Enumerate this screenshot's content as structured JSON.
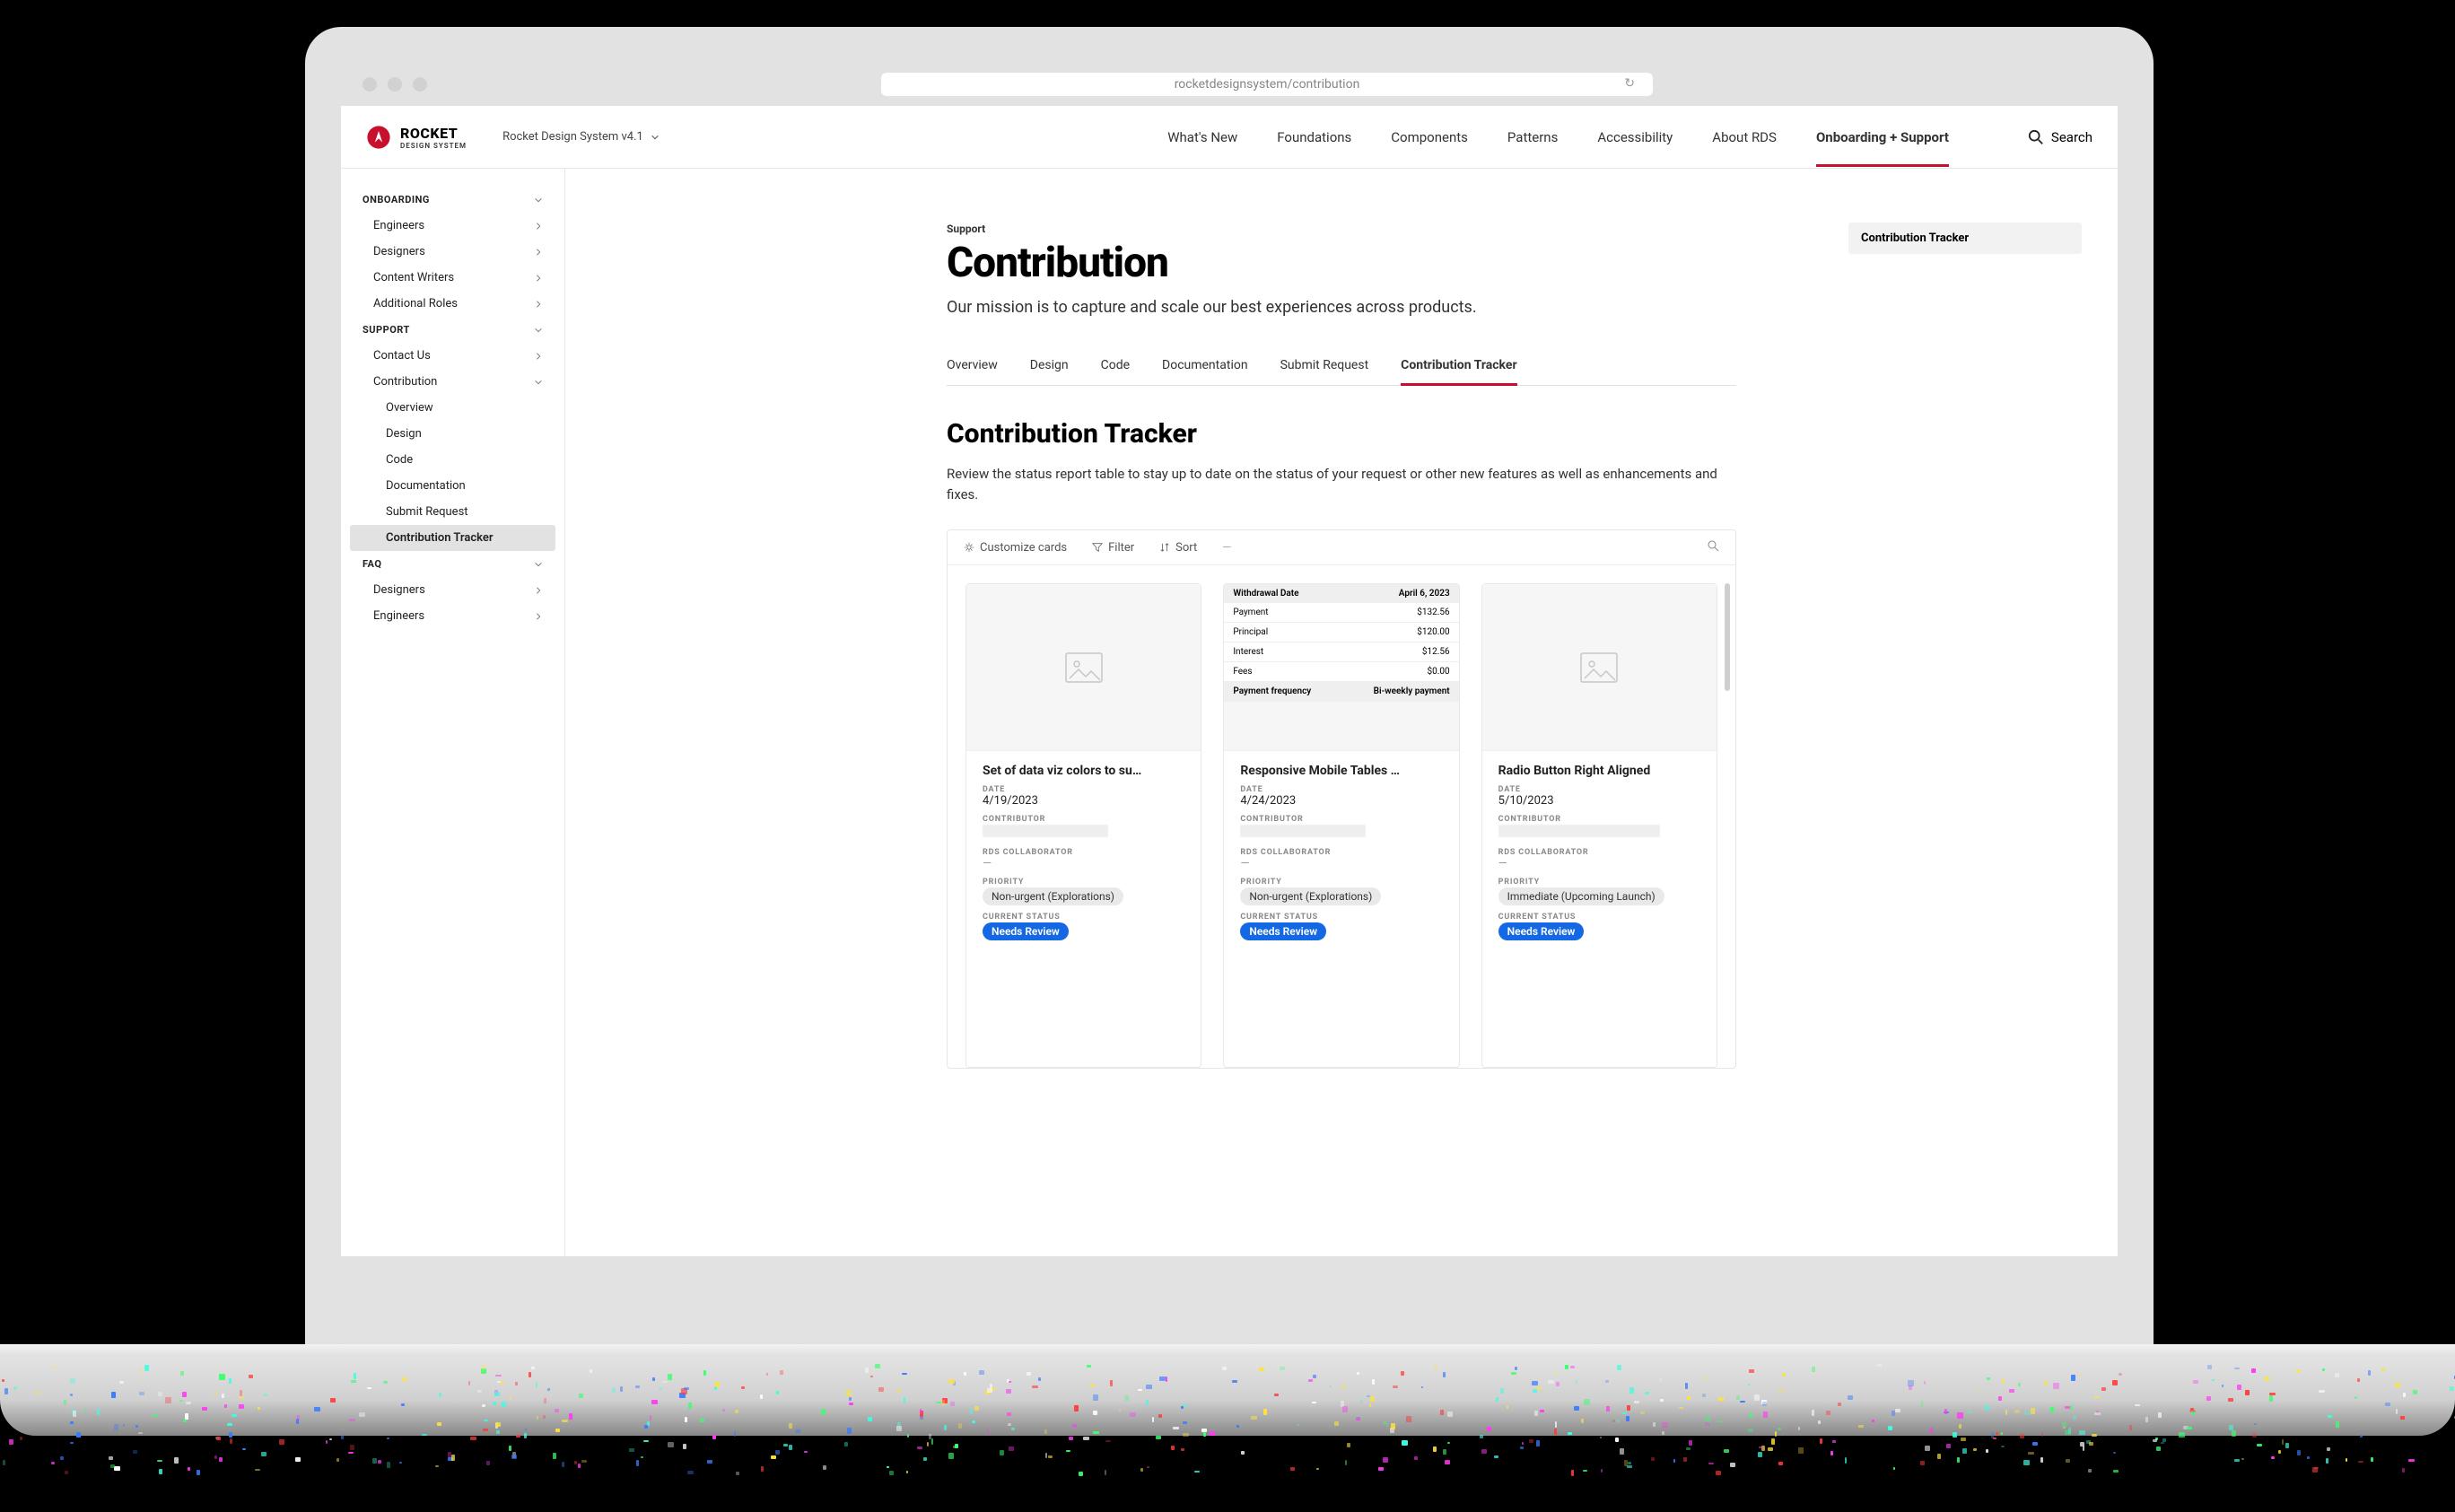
{
  "browser": {
    "url": "rocketdesignsystem/contribution"
  },
  "brand": {
    "name": "ROCKET",
    "sub": "DESIGN SYSTEM",
    "version_label": "Rocket Design System v4.1"
  },
  "nav": {
    "items": [
      {
        "label": "What's New"
      },
      {
        "label": "Foundations"
      },
      {
        "label": "Components"
      },
      {
        "label": "Patterns"
      },
      {
        "label": "Accessibility"
      },
      {
        "label": "About RDS"
      },
      {
        "label": "Onboarding + Support",
        "active": true
      }
    ],
    "search_label": "Search"
  },
  "sidebar": {
    "groups": [
      {
        "label": "ONBOARDING",
        "items": [
          {
            "label": "Engineers"
          },
          {
            "label": "Designers"
          },
          {
            "label": "Content Writers"
          },
          {
            "label": "Additional Roles"
          }
        ]
      },
      {
        "label": "SUPPORT",
        "items": [
          {
            "label": "Contact Us"
          },
          {
            "label": "Contribution",
            "expanded": true,
            "children": [
              {
                "label": "Overview"
              },
              {
                "label": "Design"
              },
              {
                "label": "Code"
              },
              {
                "label": "Documentation"
              },
              {
                "label": "Submit Request"
              },
              {
                "label": "Contribution Tracker",
                "active": true
              }
            ]
          }
        ]
      },
      {
        "label": "FAQ",
        "items": [
          {
            "label": "Designers"
          },
          {
            "label": "Engineers"
          }
        ]
      }
    ]
  },
  "page": {
    "breadcrumb": "Support",
    "title": "Contribution",
    "subtitle": "Our mission is to capture and scale our best experiences across products.",
    "tabs": [
      {
        "label": "Overview"
      },
      {
        "label": "Design"
      },
      {
        "label": "Code"
      },
      {
        "label": "Documentation"
      },
      {
        "label": "Submit Request"
      },
      {
        "label": "Contribution Tracker",
        "active": true
      }
    ],
    "section_title": "Contribution Tracker",
    "section_desc": "Review the status report table to stay up to date on the status of your request or other new features as well as enhancements and fixes.",
    "toc": {
      "item": "Contribution Tracker"
    }
  },
  "board": {
    "toolbar": {
      "customize": "Customize cards",
      "filter": "Filter",
      "sort": "Sort",
      "more": "—"
    }
  },
  "cards": [
    {
      "title": "Set of data viz colors to su…",
      "date_label": "DATE",
      "date": "4/19/2023",
      "contributor_label": "CONTRIBUTOR",
      "collab_label": "RDS COLLABORATOR",
      "collab_value": "—",
      "priority_label": "PRIORITY",
      "priority": "Non-urgent (Explorations)",
      "status_label": "CURRENT STATUS",
      "status": "Needs Review",
      "preview": "placeholder"
    },
    {
      "title": "Responsive Mobile Tables …",
      "date_label": "DATE",
      "date": "4/24/2023",
      "contributor_label": "CONTRIBUTOR",
      "collab_label": "RDS COLLABORATOR",
      "collab_value": "—",
      "priority_label": "PRIORITY",
      "priority": "Non-urgent (Explorations)",
      "status_label": "CURRENT STATUS",
      "status": "Needs Review",
      "preview": "table",
      "preview_table": {
        "header": [
          "Withdrawal Date",
          "April 6, 2023"
        ],
        "rows": [
          [
            "Payment",
            "$132.56"
          ],
          [
            "Principal",
            "$120.00"
          ],
          [
            "Interest",
            "$12.56"
          ],
          [
            "Fees",
            "$0.00"
          ],
          [
            "Payment frequency",
            "Bi-weekly payment"
          ]
        ]
      }
    },
    {
      "title": "Radio Button Right Aligned",
      "date_label": "DATE",
      "date": "5/10/2023",
      "contributor_label": "CONTRIBUTOR",
      "collab_label": "RDS COLLABORATOR",
      "collab_value": "—",
      "priority_label": "PRIORITY",
      "priority": "Immediate (Upcoming Launch)",
      "status_label": "CURRENT STATUS",
      "status": "Needs Review",
      "preview": "placeholder"
    }
  ]
}
